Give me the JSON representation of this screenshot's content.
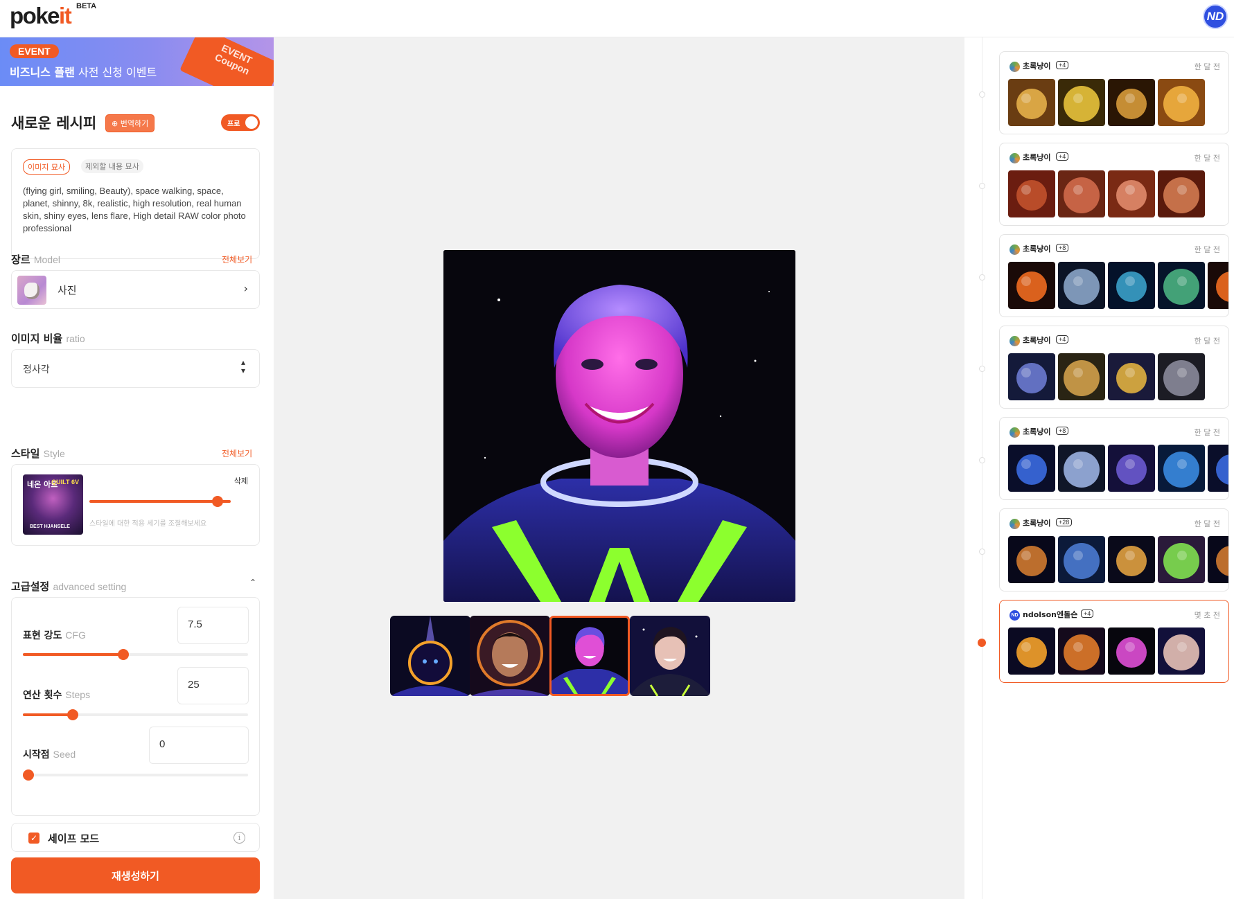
{
  "header": {
    "logo_main": "poke",
    "logo_accent": "it",
    "logo_badge": "BETA",
    "user_initials": "ND"
  },
  "event": {
    "badge": "EVENT",
    "title_bold": "비즈니스 플랜",
    "title_rest": " 사전 신청 이벤트",
    "coupon_line1": "EVENT",
    "coupon_line2": "Coupon"
  },
  "recipe": {
    "title": "새로운 레시피",
    "translate_label": "⊕ 번역하기",
    "pro_label": "프로",
    "pro_enabled": true
  },
  "prompt": {
    "tab_positive": "이미지 묘사",
    "tab_negative": "제외할 내용 묘사",
    "text": "(flying girl, smiling, Beauty), space walking, space, planet, shinny, 8k, realistic, high resolution, real human skin, shiny eyes, lens flare, High detail RAW color photo professional"
  },
  "model": {
    "label": "장르",
    "label_en": "Model",
    "see_all": "전체보기",
    "value": "사진"
  },
  "ratio": {
    "label": "이미지 비율",
    "label_en": "ratio",
    "value": "정사각"
  },
  "style": {
    "label": "스타일",
    "label_en": "Style",
    "see_all": "전체보기",
    "thumb_title": "네온 아트",
    "thumb_corner": "QUILT 6V",
    "thumb_caption": "BEST HJANSELE",
    "delete_label": "삭제",
    "hint": "스타일에 대한 적용 세기를 조절해보세요",
    "strength": 1.0
  },
  "advanced": {
    "label": "고급설정",
    "label_en": "advanced setting",
    "cfg": {
      "label": "표현 강도",
      "label_en": "CFG",
      "value": "7.5",
      "fraction": 0.5
    },
    "steps": {
      "label": "연산 횟수",
      "label_en": "Steps",
      "value": "25",
      "fraction": 0.25
    },
    "seed": {
      "label": "시작점",
      "label_en": "Seed",
      "value": "0",
      "fraction": 0.0
    }
  },
  "safe_mode": {
    "label": "세이프 모드",
    "checked": true
  },
  "regenerate_label": "재생성하기",
  "history": [
    {
      "user": "초록냥이",
      "count": "+4",
      "time": "한 달 전",
      "theme": "gold"
    },
    {
      "user": "초록냥이",
      "count": "+4",
      "time": "한 달 전",
      "theme": "mars"
    },
    {
      "user": "초록냥이",
      "count": "+8",
      "time": "한 달 전",
      "theme": "earth"
    },
    {
      "user": "초록냥이",
      "count": "+4",
      "time": "한 달 전",
      "theme": "robot"
    },
    {
      "user": "초록냥이",
      "count": "+8",
      "time": "한 달 전",
      "theme": "cat"
    },
    {
      "user": "초록냥이",
      "count": "+28",
      "time": "한 달 전",
      "theme": "cosmos"
    },
    {
      "user": "ndolson엔돌슨",
      "count": "+4",
      "time": "몇 초 전",
      "theme": "astro",
      "active": true
    }
  ],
  "colors": {
    "accent": "#f15a24",
    "avatar_blue": "#2f4fe0"
  }
}
